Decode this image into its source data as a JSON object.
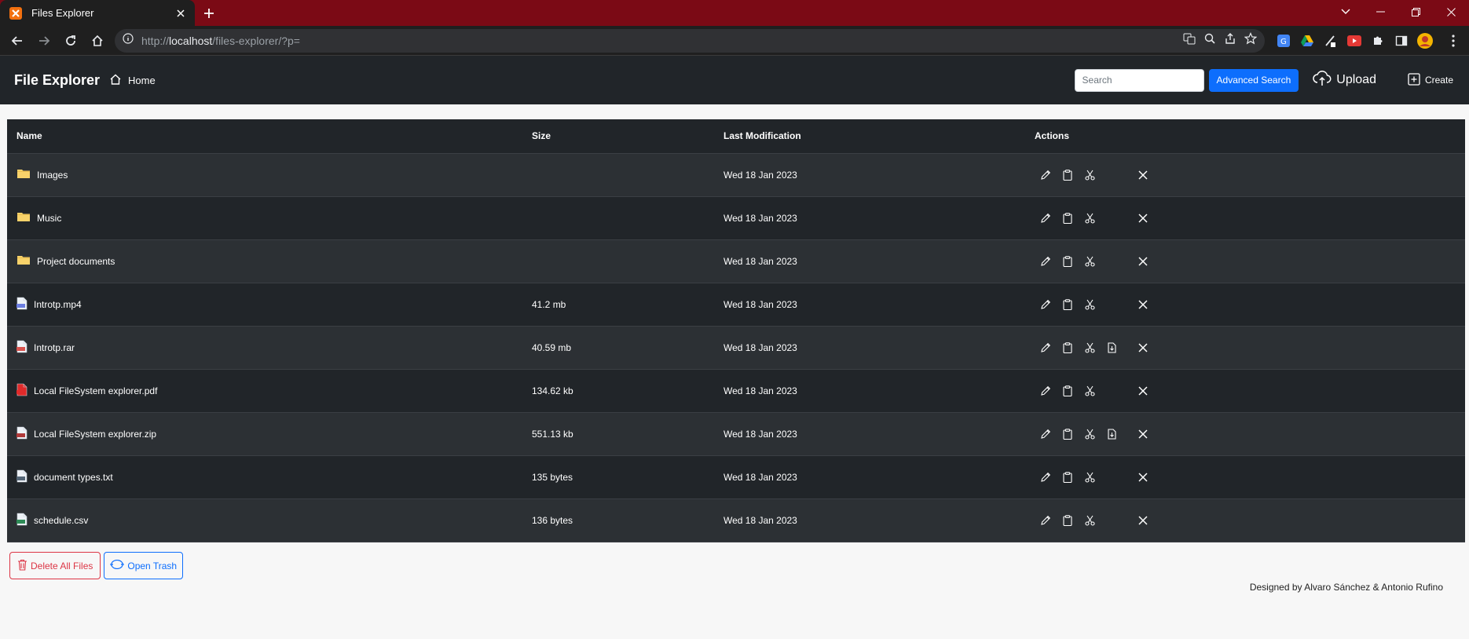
{
  "browser": {
    "tab_title": "Files Explorer",
    "url_prefix": "http://",
    "url_host": "localhost",
    "url_path": "/files-explorer/?p="
  },
  "header": {
    "brand": "File Explorer",
    "home_label": "Home",
    "search_placeholder": "Search",
    "advanced_search_label": "Advanced Search",
    "upload_label": "Upload",
    "create_label": "Create"
  },
  "table": {
    "columns": [
      "Name",
      "Size",
      "Last Modification",
      "Actions"
    ],
    "rows": [
      {
        "icon": "folder-icon",
        "name": "Images",
        "size": "",
        "modified": "Wed 18 Jan 2023",
        "extract": false
      },
      {
        "icon": "folder-icon",
        "name": "Music",
        "size": "",
        "modified": "Wed 18 Jan 2023",
        "extract": false
      },
      {
        "icon": "folder-icon",
        "name": "Project documents",
        "size": "",
        "modified": "Wed 18 Jan 2023",
        "extract": false
      },
      {
        "icon": "video-file-icon",
        "name": "Introtp.mp4",
        "size": "41.2 mb",
        "modified": "Wed 18 Jan 2023",
        "extract": false
      },
      {
        "icon": "rar-file-icon",
        "name": "Introtp.rar",
        "size": "40.59 mb",
        "modified": "Wed 18 Jan 2023",
        "extract": true
      },
      {
        "icon": "pdf-file-icon",
        "name": "Local FileSystem explorer.pdf",
        "size": "134.62 kb",
        "modified": "Wed 18 Jan 2023",
        "extract": false
      },
      {
        "icon": "zip-file-icon",
        "name": "Local FileSystem explorer.zip",
        "size": "551.13 kb",
        "modified": "Wed 18 Jan 2023",
        "extract": true
      },
      {
        "icon": "text-file-icon",
        "name": "document types.txt",
        "size": "135 bytes",
        "modified": "Wed 18 Jan 2023",
        "extract": false
      },
      {
        "icon": "csv-file-icon",
        "name": "schedule.csv",
        "size": "136 bytes",
        "modified": "Wed 18 Jan 2023",
        "extract": false
      }
    ]
  },
  "bottom": {
    "delete_all_label": "Delete All Files",
    "open_trash_label": "Open Trash"
  },
  "footer": {
    "credits": "Designed by Alvaro Sánchez & Antonio Rufino"
  },
  "colors": {
    "titlebar": "#7b0a15",
    "header_bg": "#212529",
    "primary": "#0d6efd",
    "danger": "#dc3545",
    "folder": "#f8d26a"
  }
}
